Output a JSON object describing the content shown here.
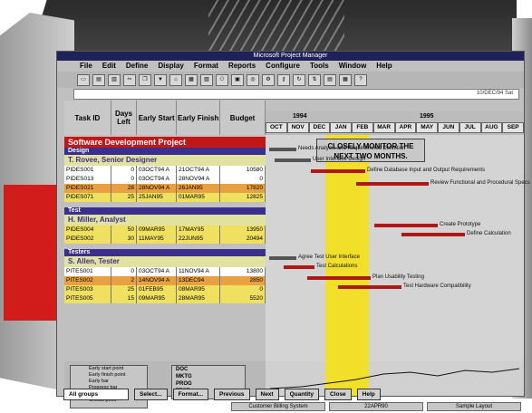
{
  "window_title": "Microsoft Project Manager",
  "menu": [
    "File",
    "Edit",
    "Define",
    "Display",
    "Format",
    "Reports",
    "Configure",
    "Tools",
    "Window",
    "Help"
  ],
  "edit_value": "10/DEC/94 Sat",
  "columns": [
    "Task ID",
    "Days Left",
    "Early Start",
    "Early Finish",
    "Budget"
  ],
  "year_labels": [
    "1994",
    "1995"
  ],
  "months": [
    "OCT",
    "NOV",
    "DEC",
    "JAN",
    "FEB",
    "MAR",
    "APR",
    "MAY",
    "JUN",
    "JUL",
    "AUG",
    "SEP"
  ],
  "project_title": "Software Development Project",
  "callout": "CLOSELY MONITOR THE NEXT TWO MONTHS.",
  "groups": [
    {
      "group": "Design",
      "person": "T. Rovee, Senior Designer",
      "rows": [
        {
          "id": "PIDES001",
          "days": "0",
          "start": "03OCT94 A",
          "finish": "21OCT94 A",
          "budget": "10580",
          "color": "w"
        },
        {
          "id": "PIDES013",
          "days": "0",
          "start": "03OCT94 A",
          "finish": "28NOV94 A",
          "budget": "0",
          "color": "w"
        },
        {
          "id": "PIDES021",
          "days": "28",
          "start": "28NOV94 A",
          "finish": "26JAN95",
          "budget": "17820",
          "color": "o"
        },
        {
          "id": "PIDES071",
          "days": "25",
          "start": "25JAN95",
          "finish": "01MAR95",
          "budget": "12825",
          "color": "y"
        }
      ]
    },
    {
      "group": "Test",
      "person": "H. Miller, Analyst",
      "rows": [
        {
          "id": "PIDES004",
          "days": "50",
          "start": "09MAR95",
          "finish": "17MAY95",
          "budget": "13950",
          "color": "y"
        },
        {
          "id": "PIDES002",
          "days": "30",
          "start": "11MAY95",
          "finish": "22JUN95",
          "budget": "20494",
          "color": "y"
        }
      ]
    },
    {
      "group": "Testers",
      "person": "S. Allen, Tester",
      "rows": [
        {
          "id": "PITES001",
          "days": "0",
          "start": "03OCT94 A",
          "finish": "11NOV94 A",
          "budget": "13800",
          "color": "w"
        },
        {
          "id": "PITES002",
          "days": "2",
          "start": "14NOV94 A",
          "finish": "13DEC94",
          "budget": "2850",
          "color": "o"
        },
        {
          "id": "PITES003",
          "days": "25",
          "start": "01FEB95",
          "finish": "08MAR95",
          "budget": "0",
          "color": "y"
        },
        {
          "id": "PITES005",
          "days": "15",
          "start": "09MAR95",
          "finish": "28MAR95",
          "budget": "5520",
          "color": "y"
        }
      ]
    }
  ],
  "gantt_labels": [
    "Needs Analysis and Requirements Definition",
    "User Interface Design",
    "Define Database Input and Output Requirements",
    "Review Functional and Procedural Specs",
    "Create Prototype",
    "Define Calculation",
    "Agree Test User Interface",
    "Test Calculations",
    "Plan Usability Testing",
    "Test Hardware Compatibility"
  ],
  "legend_bars": [
    "Early start point",
    "Early finish point",
    "Early bar",
    "Progress bar",
    "Critical bar",
    "Critical point"
  ],
  "legend_resources": [
    "DOC",
    "MKTG",
    "PROG",
    "TEST"
  ],
  "buttons": [
    "Select...",
    "Format...",
    "Previous",
    "Next",
    "Quantity",
    "Close",
    "Help"
  ],
  "group_select": "All groups",
  "status": [
    "Customer Billing System",
    "22APR90",
    "Sample Layout"
  ],
  "colors": {
    "accent_red": "#c41616",
    "group_blue": "#3a2f8c",
    "highlight": "#f2df2a"
  }
}
